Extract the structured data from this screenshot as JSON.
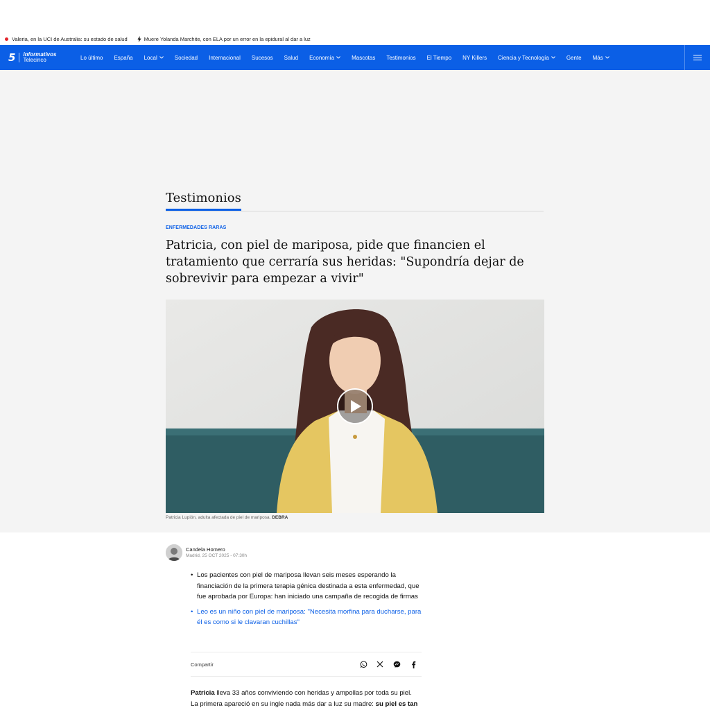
{
  "ticker": [
    {
      "text": "Valeria, en la UCI de Australia: su estado de salud"
    },
    {
      "text": "Muere Yolanda Marchite, con ELA por un error en la epidural al dar a luz"
    }
  ],
  "nav": {
    "logo_number": "5",
    "logo_top": "informativos",
    "logo_bottom": "Telecinco",
    "items": [
      {
        "label": "Lo último"
      },
      {
        "label": "España"
      },
      {
        "label": "Local"
      },
      {
        "label": "Sociedad"
      },
      {
        "label": "Internacional"
      },
      {
        "label": "Sucesos"
      },
      {
        "label": "Salud"
      },
      {
        "label": "Economía"
      },
      {
        "label": "Mascotas"
      },
      {
        "label": "Testimonios"
      },
      {
        "label": "El Tiempo"
      },
      {
        "label": "NY Killers"
      },
      {
        "label": "Ciencia y Tecnología"
      },
      {
        "label": "Gente"
      },
      {
        "label": "Más"
      }
    ]
  },
  "section": {
    "title": "Testimonios"
  },
  "article": {
    "kicker": "ENFERMEDADES RARAS",
    "headline": "Patricia, con piel de mariposa, pide que financien el tratamiento que cerraría sus heridas: \"Supondría dejar de sobrevivir para empezar a vivir\"",
    "caption_text": "Patricia Lupión, adulta afectada de piel de mariposa. ",
    "caption_credit": "DEBRA",
    "author": "Candela Homero",
    "date": "Madrid, 25 OCT 2025 - 07:30h",
    "summary": [
      "Los pacientes con piel de mariposa llevan seis meses esperando la financiación de la primera terapia génica destinada a esta enfermedad, que fue aprobada por Europa: han iniciado una campaña de recogida de firmas",
      "Leo es un niño con piel de mariposa: \"Necesita morfina para ducharse, para él es como si le clavaran cuchillas\""
    ],
    "share_label": "Compartir",
    "body_name": "Patricia",
    "body_line1": " lleva 33 años conviviendo con heridas y ampollas por toda su piel.",
    "body_line2": "La primera apareció en su ingle nada más dar a luz su madre: ",
    "body_bold2": "su piel es tan"
  },
  "colors": {
    "brand": "#0b5fe6",
    "hero_bg": "#f4f4f4",
    "alert": "#e3242b"
  },
  "icons": [
    "bolt-icon",
    "chevron-down-icon",
    "menu-icon",
    "play-icon",
    "whatsapp-icon",
    "x-icon",
    "messenger-icon",
    "facebook-icon"
  ]
}
